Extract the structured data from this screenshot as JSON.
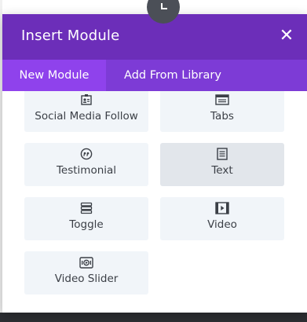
{
  "modal": {
    "title": "Insert Module",
    "close_glyph": "✕"
  },
  "tabs": [
    {
      "label": "New Module",
      "active": true
    },
    {
      "label": "From Library",
      "prefix": "Add",
      "full": "Add From Library",
      "active": false
    }
  ],
  "modules": [
    {
      "label": "Social Media Follow",
      "icon": "social-follow-icon"
    },
    {
      "label": "Tabs",
      "icon": "tabs-icon"
    },
    {
      "label": "Testimonial",
      "icon": "quote-icon"
    },
    {
      "label": "Text",
      "icon": "text-icon",
      "hovered": true
    },
    {
      "label": "Toggle",
      "icon": "toggle-icon"
    },
    {
      "label": "Video",
      "icon": "video-icon"
    },
    {
      "label": "Video Slider",
      "icon": "video-slider-icon"
    }
  ],
  "colors": {
    "header": "#6c2eb9",
    "tabs_bar": "#7d3bd6",
    "active_tab": "#8f42ec",
    "card": "#f1f5f9",
    "card_hover": "#e2e6eb",
    "text": "#3b3f46"
  }
}
